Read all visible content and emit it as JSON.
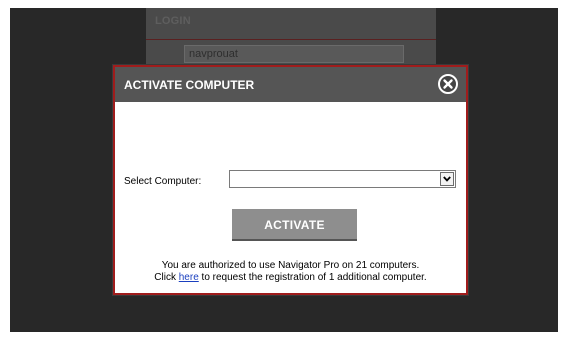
{
  "login": {
    "title": "LOGIN",
    "username_value": "navprouat"
  },
  "dialog": {
    "title": "ACTIVATE COMPUTER",
    "close_icon": "close-circle-icon",
    "select_label": "Select Computer:",
    "select_value": "",
    "dropdown_icon": "chevron-down-icon",
    "activate_label": "ACTIVATE",
    "info_line1": "You are authorized to use Navigator Pro on 21 computers.",
    "info_click": "Click",
    "info_link": "here",
    "info_rest": "to request the registration of 1 additional computer."
  },
  "colors": {
    "backdrop": "#282828",
    "dialog_header": "#555555",
    "dialog_border": "#a01c1c",
    "activate_button": "#8e8e8e",
    "link": "#1a3fbf"
  }
}
